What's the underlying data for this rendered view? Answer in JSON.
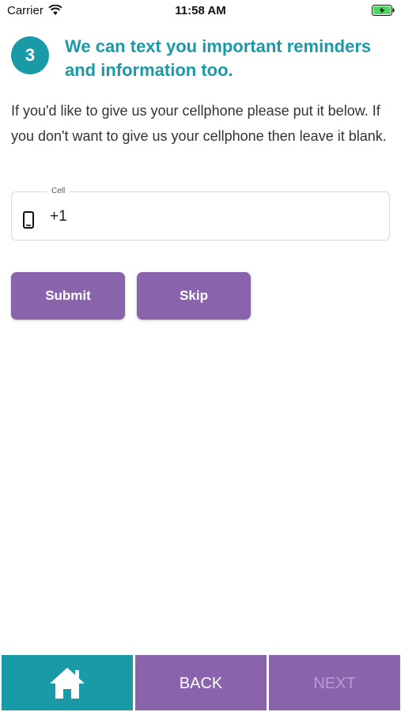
{
  "status_bar": {
    "carrier": "Carrier",
    "time": "11:58 AM",
    "wifi_icon": "wifi-icon",
    "battery_icon": "battery-charging-icon"
  },
  "step": {
    "number": "3",
    "title": "We can text you important reminders and information too."
  },
  "instructions": "If you'd like to give us your cellphone please put it below. If you don't want to give us your cellphone then leave it blank.",
  "cell_field": {
    "label": "Cell",
    "value": "+1",
    "icon": "mobile-phone-icon"
  },
  "buttons": {
    "submit": "Submit",
    "skip": "Skip"
  },
  "bottom_nav": {
    "home_icon": "home-icon",
    "back": "BACK",
    "next": "NEXT"
  },
  "colors": {
    "teal": "#1a9aa6",
    "purple": "#8a63ad",
    "next_disabled_text": "#b79bd0"
  }
}
